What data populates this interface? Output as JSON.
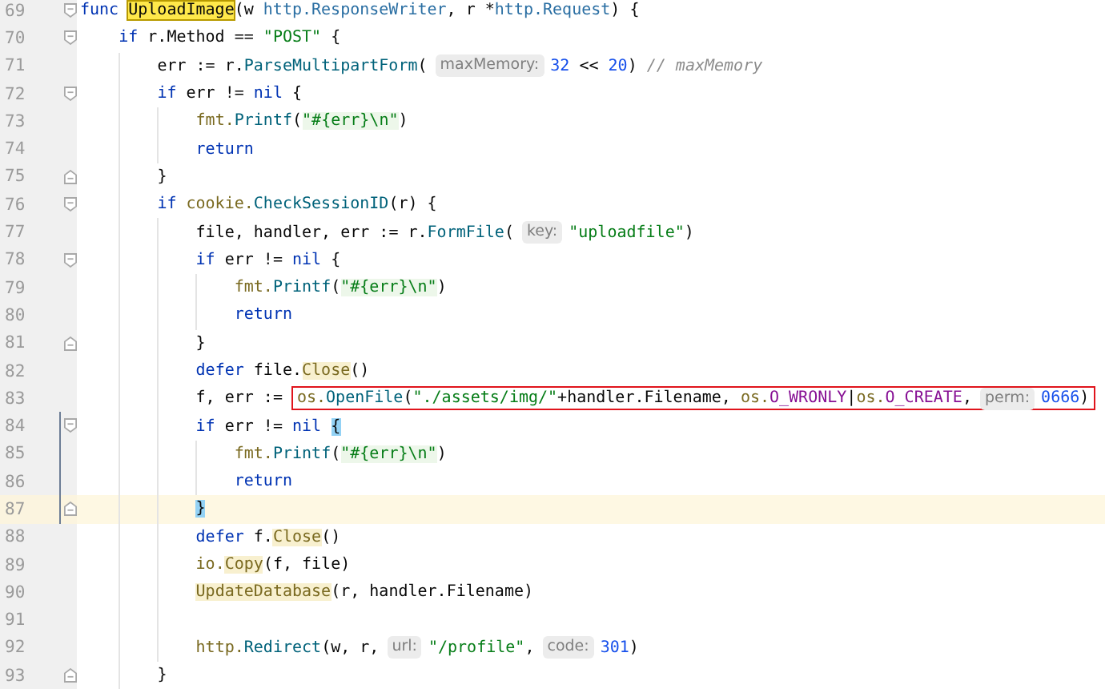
{
  "editor": {
    "lines": [
      {
        "number": "69",
        "fold_start": true,
        "fold_end": false,
        "scope": false,
        "current": false,
        "tokens": [
          {
            "t": "func ",
            "kind": "keyword"
          },
          {
            "t": "UploadImage",
            "kind": "match"
          },
          {
            "t": "(w ",
            "kind": "plain"
          },
          {
            "t": "http.ResponseWriter",
            "kind": "type"
          },
          {
            "t": ", r *",
            "kind": "plain"
          },
          {
            "t": "http.Request",
            "kind": "type"
          },
          {
            "t": ") {",
            "kind": "plain"
          }
        ],
        "children": [
          {
            "number": "70",
            "fold_start": true,
            "fold_end": false,
            "scope": false,
            "current": false,
            "tokens": [
              {
                "t": "if",
                "kind": "keyword"
              },
              {
                "t": " r.Method == ",
                "kind": "plain"
              },
              {
                "t": "\"POST\"",
                "kind": "string"
              },
              {
                "t": " {",
                "kind": "plain"
              }
            ],
            "children": [
              {
                "number": "71",
                "fold_start": false,
                "fold_end": false,
                "scope": false,
                "current": false,
                "tokens": [
                  {
                    "t": "err := r.",
                    "kind": "plain"
                  },
                  {
                    "t": "ParseMultipartForm",
                    "kind": "function"
                  },
                  {
                    "t": "(",
                    "kind": "plain"
                  },
                  {
                    "t": "maxMemory:",
                    "kind": "hint"
                  },
                  {
                    "t": "32",
                    "kind": "number"
                  },
                  {
                    "t": " << ",
                    "kind": "plain"
                  },
                  {
                    "t": "20",
                    "kind": "number"
                  },
                  {
                    "t": ") ",
                    "kind": "plain"
                  },
                  {
                    "t": "// maxMemory",
                    "kind": "comment"
                  }
                ]
              },
              {
                "number": "72",
                "fold_start": true,
                "fold_end": false,
                "scope": false,
                "current": false,
                "tokens": [
                  {
                    "t": "if",
                    "kind": "keyword"
                  },
                  {
                    "t": " err != ",
                    "kind": "plain"
                  },
                  {
                    "t": "nil",
                    "kind": "keyword"
                  },
                  {
                    "t": " {",
                    "kind": "plain"
                  }
                ],
                "children": [
                  {
                    "number": "73",
                    "fold_start": false,
                    "fold_end": false,
                    "scope": false,
                    "current": false,
                    "tokens": [
                      {
                        "t": "fmt.",
                        "kind": "package"
                      },
                      {
                        "t": "Printf",
                        "kind": "function"
                      },
                      {
                        "t": "(",
                        "kind": "plain"
                      },
                      {
                        "t": "\"#{err}\\n\"",
                        "kind": "injected"
                      },
                      {
                        "t": ")",
                        "kind": "plain"
                      }
                    ]
                  },
                  {
                    "number": "74",
                    "fold_start": false,
                    "fold_end": false,
                    "scope": false,
                    "current": false,
                    "tokens": [
                      {
                        "t": "return",
                        "kind": "keyword"
                      }
                    ]
                  }
                ]
              },
              {
                "number": "75",
                "fold_start": false,
                "fold_end": true,
                "scope": false,
                "current": false,
                "tokens": [
                  {
                    "t": "}",
                    "kind": "plain"
                  }
                ]
              },
              {
                "number": "76",
                "fold_start": true,
                "fold_end": false,
                "scope": false,
                "current": false,
                "tokens": [
                  {
                    "t": "if ",
                    "kind": "keyword"
                  },
                  {
                    "t": "cookie.",
                    "kind": "package"
                  },
                  {
                    "t": "CheckSessionID",
                    "kind": "function"
                  },
                  {
                    "t": "(r) {",
                    "kind": "plain"
                  }
                ],
                "children": [
                  {
                    "number": "77",
                    "fold_start": false,
                    "fold_end": false,
                    "scope": false,
                    "current": false,
                    "tokens": [
                      {
                        "t": "file, handler, err := r.",
                        "kind": "plain"
                      },
                      {
                        "t": "FormFile",
                        "kind": "function"
                      },
                      {
                        "t": "(",
                        "kind": "plain"
                      },
                      {
                        "t": "key:",
                        "kind": "hint"
                      },
                      {
                        "t": "\"uploadfile\"",
                        "kind": "string"
                      },
                      {
                        "t": ")",
                        "kind": "plain"
                      }
                    ]
                  },
                  {
                    "number": "78",
                    "fold_start": true,
                    "fold_end": false,
                    "scope": false,
                    "current": false,
                    "tokens": [
                      {
                        "t": "if",
                        "kind": "keyword"
                      },
                      {
                        "t": " err != ",
                        "kind": "plain"
                      },
                      {
                        "t": "nil",
                        "kind": "keyword"
                      },
                      {
                        "t": " {",
                        "kind": "plain"
                      }
                    ],
                    "children": [
                      {
                        "number": "79",
                        "fold_start": false,
                        "fold_end": false,
                        "scope": false,
                        "current": false,
                        "tokens": [
                          {
                            "t": "fmt.",
                            "kind": "package"
                          },
                          {
                            "t": "Printf",
                            "kind": "function"
                          },
                          {
                            "t": "(",
                            "kind": "plain"
                          },
                          {
                            "t": "\"#{err}\\n\"",
                            "kind": "injected"
                          },
                          {
                            "t": ")",
                            "kind": "plain"
                          }
                        ]
                      },
                      {
                        "number": "80",
                        "fold_start": false,
                        "fold_end": false,
                        "scope": false,
                        "current": false,
                        "tokens": [
                          {
                            "t": "return",
                            "kind": "keyword"
                          }
                        ]
                      }
                    ]
                  },
                  {
                    "number": "81",
                    "fold_start": false,
                    "fold_end": true,
                    "scope": false,
                    "current": false,
                    "tokens": [
                      {
                        "t": "}",
                        "kind": "plain"
                      }
                    ]
                  },
                  {
                    "number": "82",
                    "fold_start": false,
                    "fold_end": false,
                    "scope": false,
                    "current": false,
                    "tokens": [
                      {
                        "t": "defer",
                        "kind": "keyword"
                      },
                      {
                        "t": " file.",
                        "kind": "plain"
                      },
                      {
                        "t": "Close",
                        "kind": "usage"
                      },
                      {
                        "t": "()",
                        "kind": "plain"
                      }
                    ]
                  },
                  {
                    "number": "83",
                    "fold_start": false,
                    "fold_end": false,
                    "scope": false,
                    "current": false,
                    "tokens": [
                      {
                        "t": "f, err :=",
                        "kind": "plain"
                      }
                    ],
                    "boxed_tokens": [
                      {
                        "t": "os.",
                        "kind": "package"
                      },
                      {
                        "t": "OpenFile",
                        "kind": "function"
                      },
                      {
                        "t": "(",
                        "kind": "plain"
                      },
                      {
                        "t": "\"./assets/img/\"",
                        "kind": "string"
                      },
                      {
                        "t": "+handler.Filename, ",
                        "kind": "plain"
                      },
                      {
                        "t": "os.",
                        "kind": "package"
                      },
                      {
                        "t": "O_WRONLY",
                        "kind": "constant"
                      },
                      {
                        "t": "|",
                        "kind": "plain"
                      },
                      {
                        "t": "os.",
                        "kind": "package"
                      },
                      {
                        "t": "O_CREATE",
                        "kind": "constant"
                      },
                      {
                        "t": ",",
                        "kind": "plain"
                      },
                      {
                        "t": "perm:",
                        "kind": "hint"
                      },
                      {
                        "t": "0666",
                        "kind": "number"
                      },
                      {
                        "t": ")",
                        "kind": "plain"
                      }
                    ]
                  },
                  {
                    "number": "84",
                    "fold_start": true,
                    "fold_end": false,
                    "scope": true,
                    "current": false,
                    "tokens": [
                      {
                        "t": "if",
                        "kind": "keyword"
                      },
                      {
                        "t": " err != ",
                        "kind": "plain"
                      },
                      {
                        "t": "nil ",
                        "kind": "keyword"
                      },
                      {
                        "t": "{",
                        "kind": "brace"
                      }
                    ],
                    "children": [
                      {
                        "number": "85",
                        "fold_start": false,
                        "fold_end": false,
                        "scope": true,
                        "current": false,
                        "tokens": [
                          {
                            "t": "fmt.",
                            "kind": "package"
                          },
                          {
                            "t": "Printf",
                            "kind": "function"
                          },
                          {
                            "t": "(",
                            "kind": "plain"
                          },
                          {
                            "t": "\"#{err}\\n\"",
                            "kind": "injected"
                          },
                          {
                            "t": ")",
                            "kind": "plain"
                          }
                        ]
                      },
                      {
                        "number": "86",
                        "fold_start": false,
                        "fold_end": false,
                        "scope": true,
                        "current": false,
                        "tokens": [
                          {
                            "t": "return",
                            "kind": "keyword"
                          }
                        ]
                      }
                    ]
                  },
                  {
                    "number": "87",
                    "fold_start": false,
                    "fold_end": true,
                    "scope": true,
                    "current": true,
                    "tokens": [
                      {
                        "t": "}",
                        "kind": "brace"
                      }
                    ]
                  },
                  {
                    "number": "88",
                    "fold_start": false,
                    "fold_end": false,
                    "scope": false,
                    "current": false,
                    "tokens": [
                      {
                        "t": "defer",
                        "kind": "keyword"
                      },
                      {
                        "t": " f.",
                        "kind": "plain"
                      },
                      {
                        "t": "Close",
                        "kind": "usage"
                      },
                      {
                        "t": "()",
                        "kind": "plain"
                      }
                    ]
                  },
                  {
                    "number": "89",
                    "fold_start": false,
                    "fold_end": false,
                    "scope": false,
                    "current": false,
                    "tokens": [
                      {
                        "t": "io.",
                        "kind": "package"
                      },
                      {
                        "t": "Copy",
                        "kind": "usage"
                      },
                      {
                        "t": "(f, file)",
                        "kind": "plain"
                      }
                    ]
                  },
                  {
                    "number": "90",
                    "fold_start": false,
                    "fold_end": false,
                    "scope": false,
                    "current": false,
                    "tokens": [
                      {
                        "t": "UpdateDatabase",
                        "kind": "usage"
                      },
                      {
                        "t": "(r, handler.Filename)",
                        "kind": "plain"
                      }
                    ]
                  },
                  {
                    "number": "91",
                    "fold_start": false,
                    "fold_end": false,
                    "scope": false,
                    "current": false
                  },
                  {
                    "number": "92",
                    "fold_start": false,
                    "fold_end": false,
                    "scope": false,
                    "current": false,
                    "tokens": [
                      {
                        "t": "http.",
                        "kind": "package"
                      },
                      {
                        "t": "Redirect",
                        "kind": "function"
                      },
                      {
                        "t": "(w, r,",
                        "kind": "plain"
                      },
                      {
                        "t": "url:",
                        "kind": "hint"
                      },
                      {
                        "t": "\"/profile\"",
                        "kind": "string"
                      },
                      {
                        "t": ",",
                        "kind": "plain"
                      },
                      {
                        "t": "code:",
                        "kind": "hint"
                      },
                      {
                        "t": "301",
                        "kind": "number"
                      },
                      {
                        "t": ")",
                        "kind": "plain"
                      }
                    ]
                  }
                ]
              },
              {
                "number": "93",
                "fold_start": false,
                "fold_end": true,
                "scope": false,
                "current": false,
                "tokens": [
                  {
                    "t": "}",
                    "kind": "plain"
                  }
                ]
              }
            ]
          }
        ]
      }
    ]
  }
}
